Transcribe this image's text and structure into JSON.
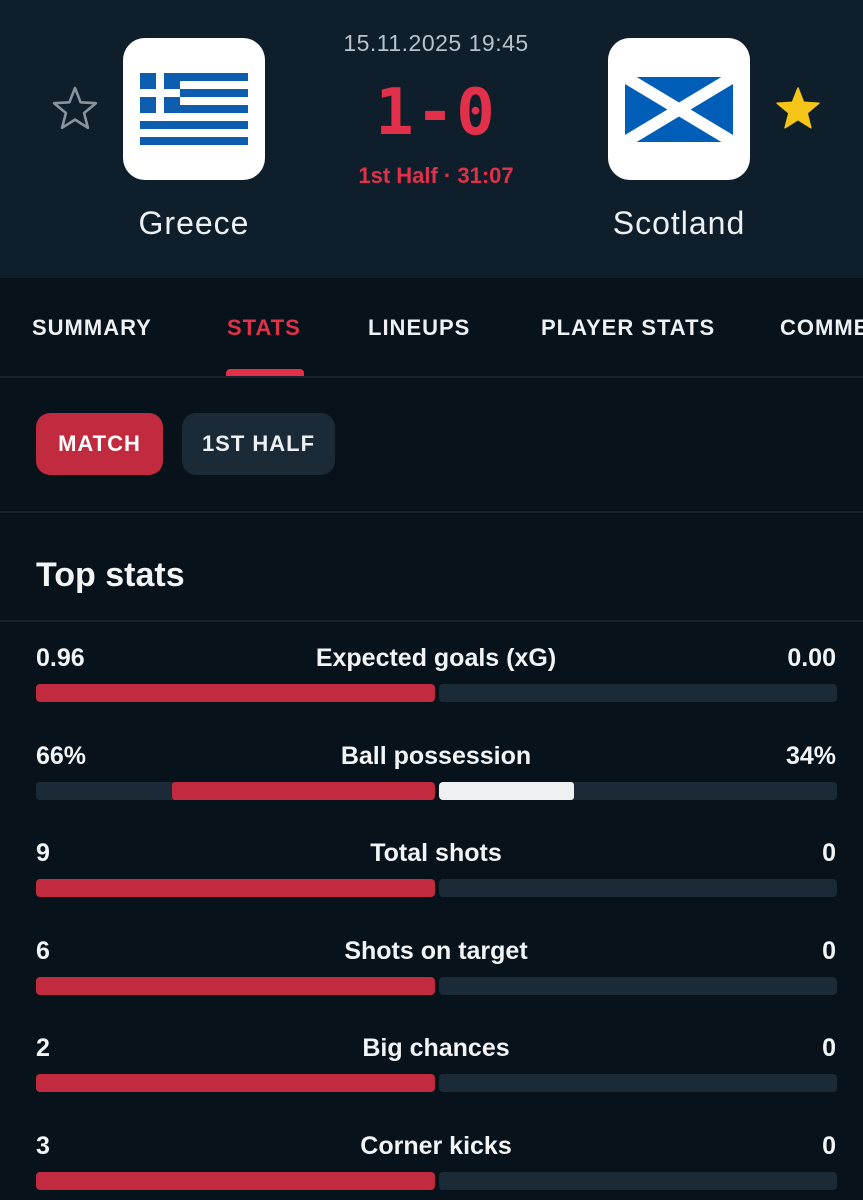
{
  "match": {
    "datetime": "15.11.2025 19:45",
    "score": "1-0",
    "status": "1st Half · 31:07",
    "home": {
      "name": "Greece",
      "favorite": false
    },
    "away": {
      "name": "Scotland",
      "favorite": true
    }
  },
  "icons": {
    "star_outline": "star-outline-icon",
    "star_filled": "star-filled-icon",
    "greece_flag": "greece-flag-icon",
    "scotland_flag": "scotland-flag-icon"
  },
  "colors": {
    "accent": "#e2304a",
    "home_bar": "#c22a3f",
    "away_bar": "#eef0f2",
    "star_active": "#f5c518",
    "header_bg": "#0e1f2b",
    "page_bg": "#07121a"
  },
  "tabs": [
    {
      "label": "SUMMARY",
      "active": false
    },
    {
      "label": "STATS",
      "active": true
    },
    {
      "label": "LINEUPS",
      "active": false
    },
    {
      "label": "PLAYER STATS",
      "active": false
    },
    {
      "label": "COMMENTARY",
      "active": false
    }
  ],
  "periods": [
    {
      "label": "MATCH",
      "active": true
    },
    {
      "label": "1ST HALF",
      "active": false
    }
  ],
  "section": {
    "title": "Top stats"
  },
  "stats": [
    {
      "label": "Expected goals (xG)",
      "home": "0.96",
      "away": "0.00",
      "home_share": 1.0,
      "away_share": 0.0
    },
    {
      "label": "Ball possession",
      "home": "66%",
      "away": "34%",
      "home_share": 0.66,
      "away_share": 0.34
    },
    {
      "label": "Total shots",
      "home": "9",
      "away": "0",
      "home_share": 1.0,
      "away_share": 0.0
    },
    {
      "label": "Shots on target",
      "home": "6",
      "away": "0",
      "home_share": 1.0,
      "away_share": 0.0
    },
    {
      "label": "Big chances",
      "home": "2",
      "away": "0",
      "home_share": 1.0,
      "away_share": 0.0
    },
    {
      "label": "Corner kicks",
      "home": "3",
      "away": "0",
      "home_share": 1.0,
      "away_share": 0.0
    }
  ]
}
